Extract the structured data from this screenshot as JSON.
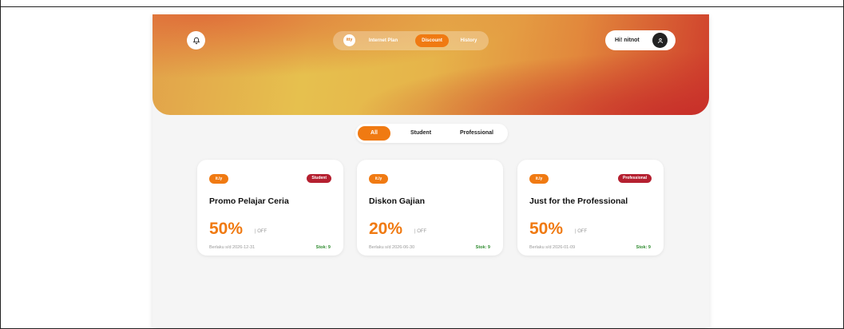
{
  "header": {
    "nav": {
      "logo_text": "itty",
      "items": [
        {
          "label": "Internet Plan"
        },
        {
          "label": "Discount"
        },
        {
          "label": "History"
        }
      ]
    },
    "greeting": "Hi! nitnot"
  },
  "filters": [
    {
      "label": "All"
    },
    {
      "label": "Student"
    },
    {
      "label": "Professional"
    }
  ],
  "cards": [
    {
      "brand": "it.ly",
      "tag": "Student",
      "title": "Promo Pelajar Ceria",
      "discount": "50%",
      "off_label": "| OFF",
      "valid": "Berlaku s/d 2026-12-31",
      "stock": "Stok: 9"
    },
    {
      "brand": "it.ly",
      "tag": "",
      "title": "Diskon Gajian",
      "discount": "20%",
      "off_label": "| OFF",
      "valid": "Berlaku s/d 2026-06-30",
      "stock": "Stok: 9"
    },
    {
      "brand": "it.ly",
      "tag": "Professional",
      "title": "Just for the Professional",
      "discount": "50%",
      "off_label": "| OFF",
      "valid": "Berlaku s/d 2026-01-09",
      "stock": "Stok: 9"
    }
  ],
  "colors": {
    "accent": "#f07a12",
    "tag": "#b52030",
    "stock": "#2e8b2e"
  },
  "icons": {
    "notification": "bell-icon",
    "avatar": "user-icon"
  }
}
